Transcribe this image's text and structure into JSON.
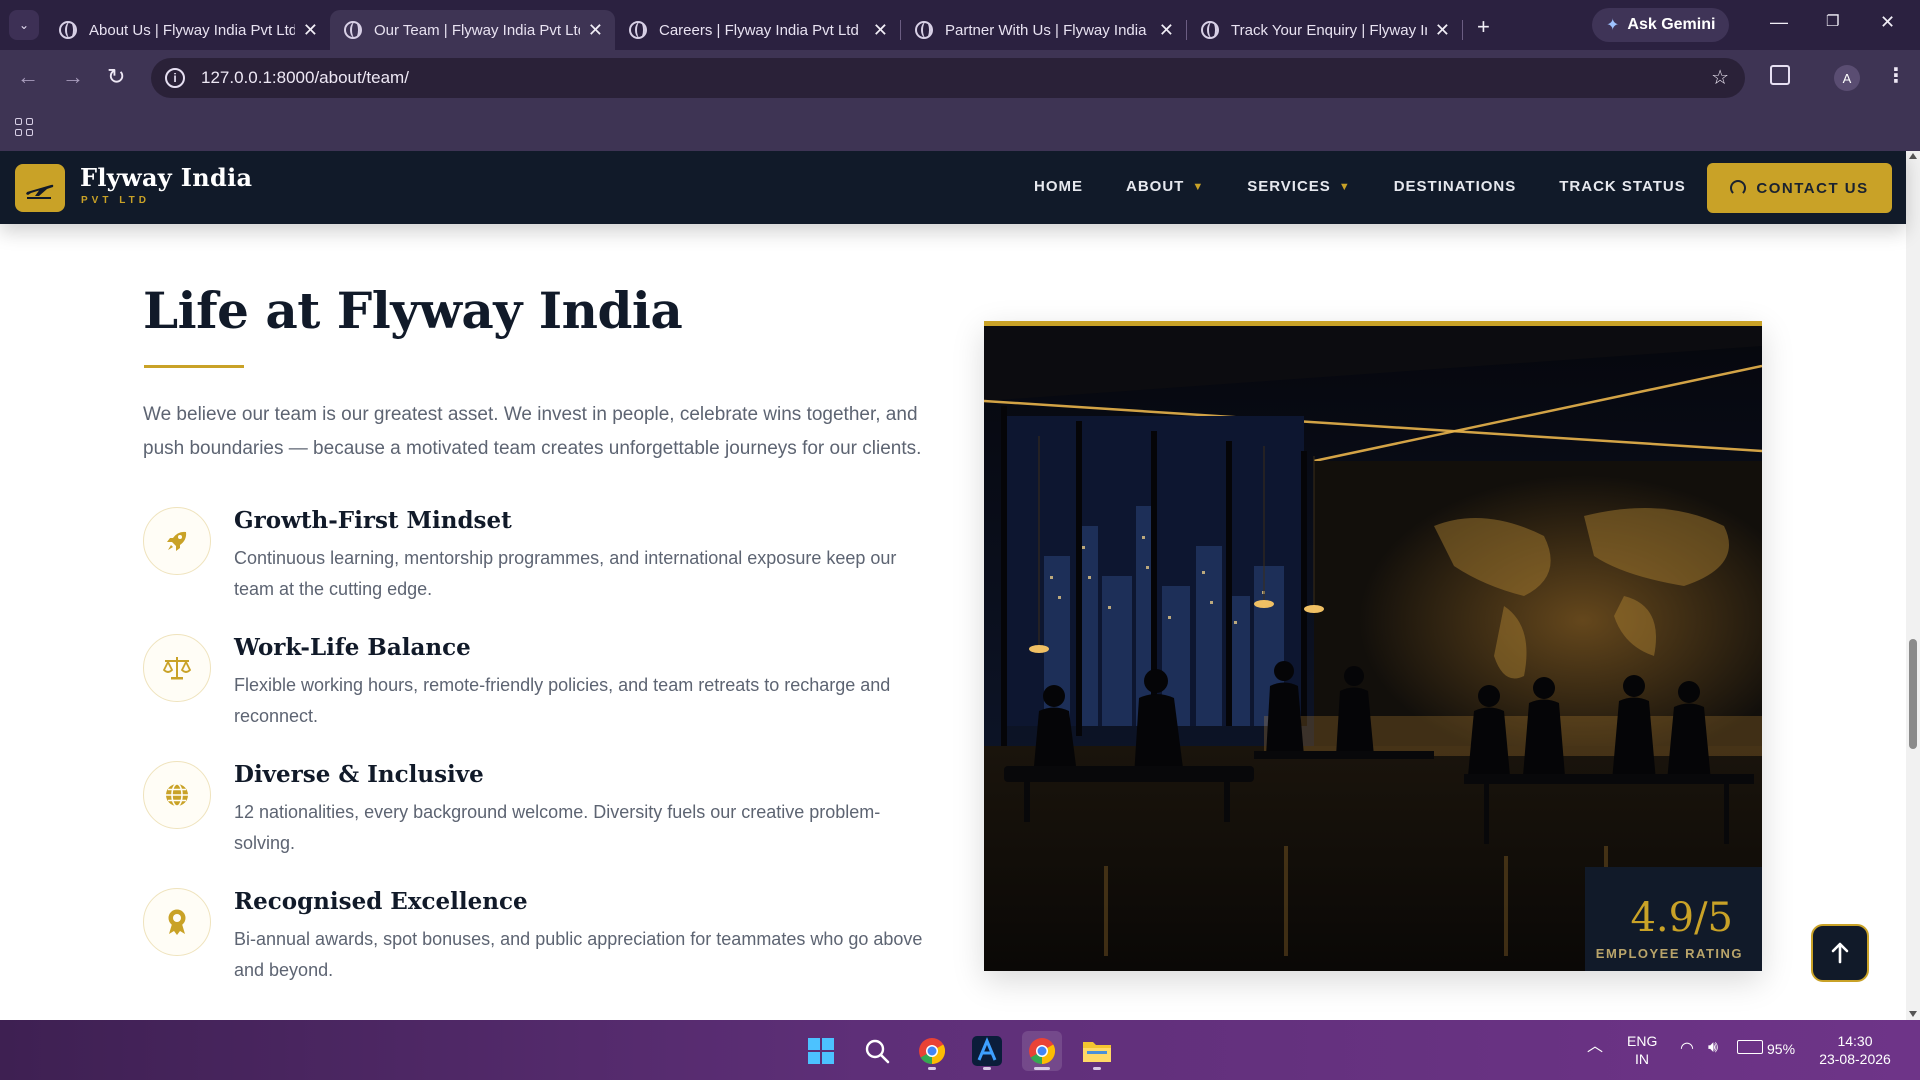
{
  "browser": {
    "tabs": [
      {
        "title": "About Us | Flyway India Pvt Ltd",
        "active": false
      },
      {
        "title": "Our Team | Flyway India Pvt Ltd",
        "active": true
      },
      {
        "title": "Careers | Flyway India Pvt Ltd",
        "active": false
      },
      {
        "title": "Partner With Us | Flyway India",
        "active": false
      },
      {
        "title": "Track Your Enquiry | Flyway India",
        "active": false
      }
    ],
    "gemini_label": "Ask Gemini",
    "url": "127.0.0.1:8000/about/team/",
    "profile_initial": "A"
  },
  "site": {
    "brand_name": "Flyway India",
    "brand_sub": "PVT LTD",
    "nav": {
      "home": "HOME",
      "about": "ABOUT",
      "services": "SERVICES",
      "destinations": "DESTINATIONS",
      "track": "TRACK STATUS"
    },
    "contact_label": "CONTACT US",
    "accent": "#c9a227",
    "navy": "#111a29"
  },
  "section": {
    "title": "Life at Flyway India",
    "intro": "We believe our team is our greatest asset. We invest in people, celebrate wins together, and push boundaries — because a motivated team creates unforgettable journeys for our clients.",
    "features": [
      {
        "icon": "rocket-icon",
        "title": "Growth-First Mindset",
        "text": "Continuous learning, mentorship programmes, and international exposure keep our team at the cutting edge."
      },
      {
        "icon": "balance-scale-icon",
        "title": "Work-Life Balance",
        "text": "Flexible working hours, remote-friendly policies, and team retreats to recharge and reconnect."
      },
      {
        "icon": "globe-icon",
        "title": "Diverse & Inclusive",
        "text": "12 nationalities, every background welcome. Diversity fuels our creative problem-solving."
      },
      {
        "icon": "award-icon",
        "title": "Recognised Excellence",
        "text": "Bi-annual awards, spot bonuses, and public appreciation for teammates who go above and beyond."
      }
    ],
    "rating_value": "4.9/5",
    "rating_label": "EMPLOYEE RATING"
  },
  "taskbar": {
    "lang": "ENG",
    "region": "IN",
    "battery": "95%",
    "time": "14:30",
    "date": "23-08-2026"
  }
}
